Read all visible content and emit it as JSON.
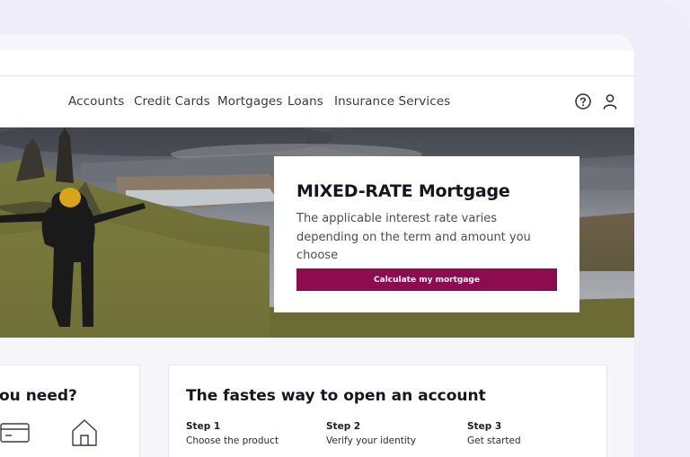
{
  "nav": {
    "items": [
      {
        "label": "Accounts"
      },
      {
        "label": "Credit Cards"
      },
      {
        "label": "Mortgages"
      },
      {
        "label": "Loans"
      },
      {
        "label": "Insurance Services"
      }
    ]
  },
  "hero": {
    "title": "MIXED-RATE Mortgage",
    "description": "The applicable interest rate varies depending on the term and amount you choose",
    "cta_label": "Calculate my mortgage"
  },
  "left_card": {
    "title": "ou need?"
  },
  "steps_card": {
    "title": "The fastes way to open an account",
    "steps": [
      {
        "label": "Step 1",
        "text": "Choose the product"
      },
      {
        "label": "Step 2",
        "text": "Verify your identity"
      },
      {
        "label": "Step 3",
        "text": "Get started"
      }
    ]
  },
  "colors": {
    "accent": "#8d0c4f",
    "page_bg": "#f1effb"
  },
  "icons": [
    "help-icon",
    "user-icon",
    "credit-card-icon",
    "home-icon"
  ]
}
